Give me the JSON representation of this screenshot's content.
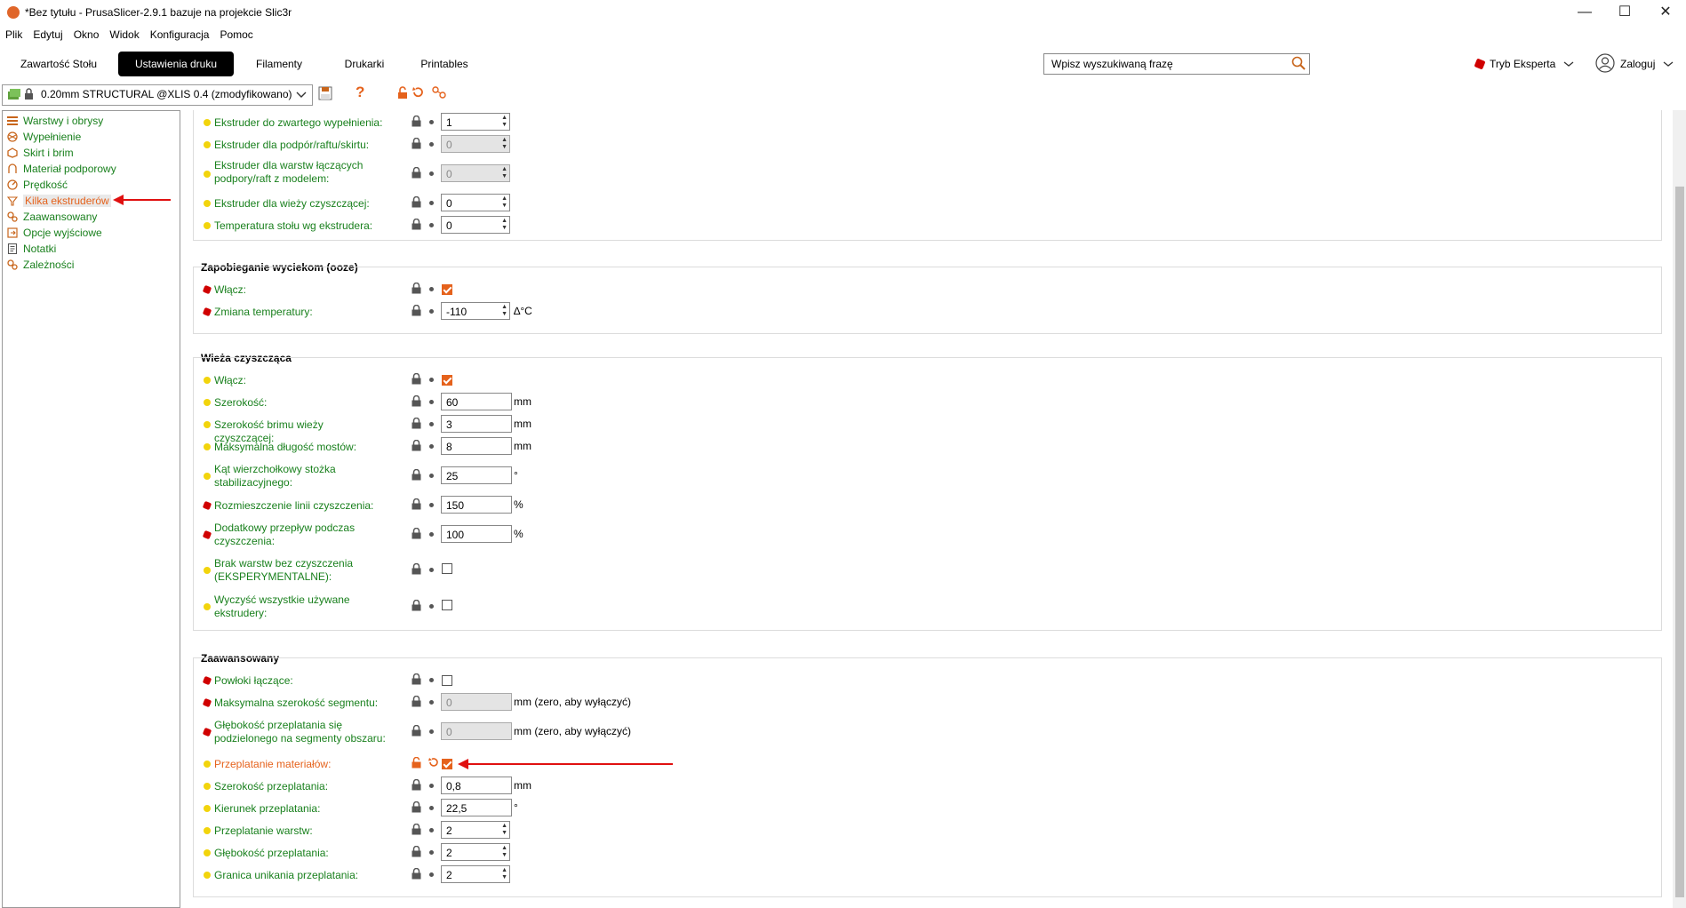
{
  "window": {
    "title": "*Bez tytułu - PrusaSlicer-2.9.1 bazuje na projekcie Slic3r",
    "minimize": "—",
    "maximize": "☐",
    "close": "✕"
  },
  "menu": [
    "Plik",
    "Edytuj",
    "Okno",
    "Widok",
    "Konfiguracja",
    "Pomoc"
  ],
  "tabs": [
    "Zawartość Stołu",
    "Ustawienia druku",
    "Filamenty",
    "Drukarki",
    "Printables"
  ],
  "active_tab": "Ustawienia druku",
  "search": {
    "placeholder": "Wpisz wyszukiwaną frazę"
  },
  "mode": {
    "label": "Tryb Eksperta"
  },
  "account": {
    "label": "Zaloguj"
  },
  "preset": {
    "name": "0.20mm STRUCTURAL @XLIS 0.4 (zmodyfikowano)"
  },
  "help_glyph": "?",
  "sidebar": {
    "items": [
      "Warstwy i obrysy",
      "Wypełnienie",
      "Skirt i brim",
      "Materiał podporowy",
      "Prędkość",
      "Kilka ekstruderów",
      "Zaawansowany",
      "Opcje wyjściowe",
      "Notatki",
      "Zależności"
    ],
    "selected": "Kilka ekstruderów"
  },
  "groups": {
    "extruders": {
      "options": [
        {
          "label": "Ekstruder do zwartego wypełnienia:",
          "value": "1"
        },
        {
          "label": "Ekstruder dla podpór/raftu/skirtu:",
          "value": "0"
        },
        {
          "label": "Ekstruder dla warstw łączących podpory/raft z modelem:",
          "value": "0"
        },
        {
          "label": "Ekstruder dla wieży czyszczącej:",
          "value": "0"
        },
        {
          "label": "Temperatura stołu wg ekstrudera:",
          "value": "0"
        }
      ]
    },
    "ooze": {
      "title": "Zapobieganie wyciekom (ooze)",
      "options": [
        {
          "label": "Włącz:"
        },
        {
          "label": "Zmiana temperatury:",
          "value": "-110",
          "unit": "∆°C"
        }
      ]
    },
    "wipe": {
      "title": "Wieża czyszcząca",
      "options": [
        {
          "label": "Włącz:"
        },
        {
          "label": "Szerokość:",
          "value": "60",
          "unit": "mm"
        },
        {
          "label": "Szerokość brimu wieży czyszczącej:",
          "value": "3",
          "unit": "mm"
        },
        {
          "label": "Maksymalna długość mostów:",
          "value": "8",
          "unit": "mm"
        },
        {
          "label": "Kąt wierzchołkowy stożka stabilizacyjnego:",
          "value": "25",
          "unit": "°"
        },
        {
          "label": "Rozmieszczenie linii czyszczenia:",
          "value": "150",
          "unit": "%"
        },
        {
          "label": "Dodatkowy przepływ podczas czyszczenia:",
          "value": "100",
          "unit": "%"
        },
        {
          "label": "Brak warstw bez czyszczenia (EKSPERYMENTALNE):"
        },
        {
          "label": "Wyczyść wszystkie używane ekstrudery:"
        }
      ]
    },
    "advanced": {
      "title": "Zaawansowany",
      "options": [
        {
          "label": "Powłoki łączące:"
        },
        {
          "label": "Maksymalna szerokość segmentu:",
          "value": "0",
          "unit": "mm (zero, aby wyłączyć)"
        },
        {
          "label": "Głębokość przeplatania się podzielonego na segmenty obszaru:",
          "value": "0",
          "unit": "mm (zero, aby wyłączyć)"
        },
        {
          "label": "Przeplatanie materiałów:"
        },
        {
          "label": "Szerokość przeplatania:",
          "value": "0,8",
          "unit": "mm"
        },
        {
          "label": "Kierunek przeplatania:",
          "value": "22,5",
          "unit": "°"
        },
        {
          "label": "Przeplatanie warstw:",
          "value": "2"
        },
        {
          "label": "Głębokość przeplatania:",
          "value": "2"
        },
        {
          "label": "Granica unikania przeplatania:",
          "value": "2"
        }
      ]
    }
  },
  "colors": {
    "accent_orange": "#e5621c",
    "label_green": "#19801d",
    "annotation_red": "#e01010"
  }
}
